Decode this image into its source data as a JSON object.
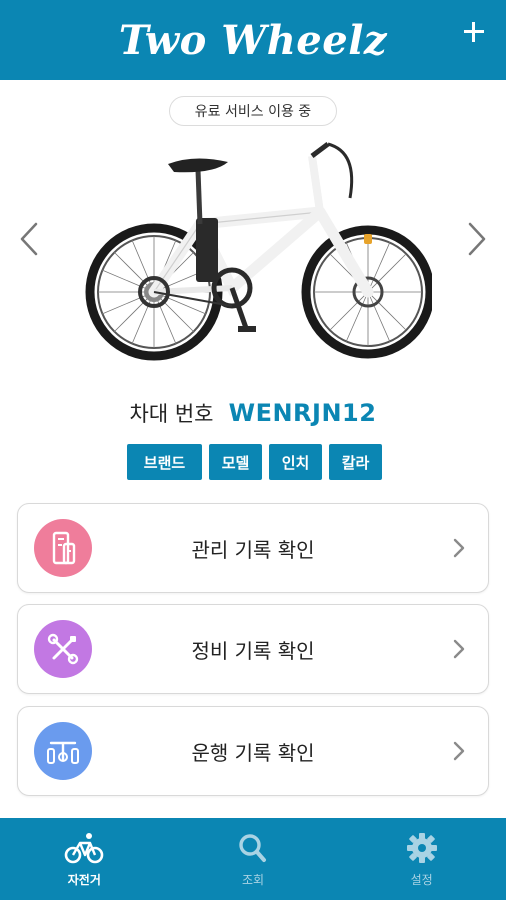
{
  "header": {
    "title": "Two Wheelz"
  },
  "status": {
    "service_label": "유료 서비스 이용 중"
  },
  "vehicle": {
    "plate_label": "차대 번호",
    "plate_number": "WENRJN12",
    "tags": [
      "브랜드",
      "모델",
      "인치",
      "칼라"
    ]
  },
  "records": [
    {
      "label": "관리 기록 확인",
      "icon": "management-record-icon",
      "color": "#ef7d9b"
    },
    {
      "label": "정비 기록 확인",
      "icon": "repair-tools-icon",
      "color": "#c278e3"
    },
    {
      "label": "운행 기록 확인",
      "icon": "bike-ride-icon",
      "color": "#6a9bee"
    }
  ],
  "bottom_nav": [
    {
      "label": "자전거",
      "icon": "bicycle-icon",
      "active": true
    },
    {
      "label": "조회",
      "icon": "search-icon",
      "active": false
    },
    {
      "label": "설정",
      "icon": "gear-icon",
      "active": false
    }
  ],
  "colors": {
    "primary": "#0b86b3",
    "nav_inactive": "#a9d3e4"
  }
}
